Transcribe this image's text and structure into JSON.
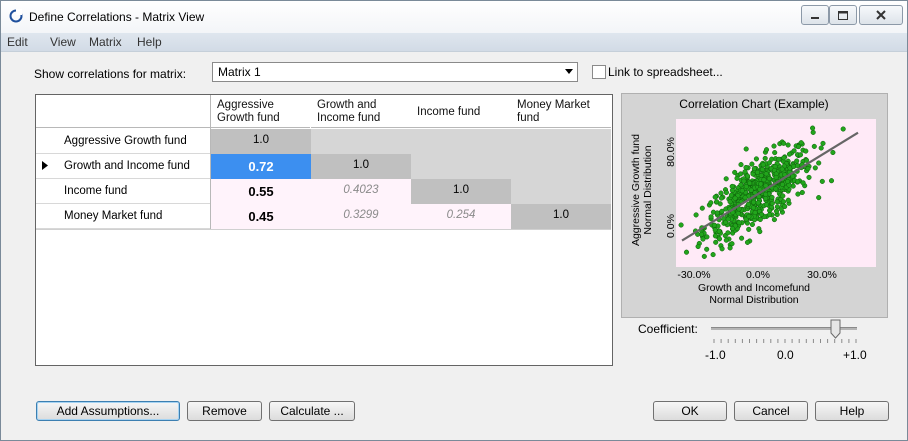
{
  "window": {
    "title": "Define Correlations - Matrix View"
  },
  "menu": [
    "Edit",
    "View",
    "Matrix",
    "Help"
  ],
  "matrix_select": {
    "label": "Show correlations for matrix:",
    "value": "Matrix 1"
  },
  "link": {
    "label": "Link to spreadsheet...",
    "checked": false
  },
  "grid": {
    "columns": [
      "Aggressive Growth fund",
      "Growth and Income fund",
      "Income fund",
      "Money Market fund"
    ],
    "column_lines": [
      [
        "Aggressive",
        "Growth fund"
      ],
      [
        "Growth and",
        "Income fund"
      ],
      [
        "Income fund"
      ],
      [
        "Money Market",
        "fund"
      ]
    ],
    "rows": [
      {
        "label": "Aggressive Growth fund",
        "cells": [
          "1.0",
          "",
          "",
          ""
        ]
      },
      {
        "label": "Growth and Income fund",
        "cells": [
          "0.72",
          "1.0",
          "",
          ""
        ],
        "current": true
      },
      {
        "label": "Income fund",
        "cells": [
          "0.55",
          "0.4023",
          "1.0",
          ""
        ]
      },
      {
        "label": "Money Market fund",
        "cells": [
          "0.45",
          "0.3299",
          "0.254",
          "1.0"
        ]
      }
    ],
    "selected_cell": "0.72"
  },
  "chart": {
    "title": "Correlation Chart (Example)",
    "ylabel": [
      "Aggressive Growth fund",
      "Normal Distribution"
    ],
    "xlabel": [
      "Growth and Incomefund",
      "Normal Distribution"
    ],
    "x_ticks": [
      "-30.0%",
      "0.0%",
      "30.0%"
    ],
    "y_ticks": [
      "0.0%",
      "80.0%"
    ],
    "point_color": "#22a51c"
  },
  "coefficient": {
    "label": "Coefficient:",
    "value": 0.72,
    "min_label": "-1.0",
    "mid_label": "0.0",
    "max_label": "+1.0"
  },
  "buttons": {
    "add": "Add Assumptions...",
    "remove": "Remove",
    "calculate": "Calculate ...",
    "ok": "OK",
    "cancel": "Cancel",
    "help": "Help"
  }
}
